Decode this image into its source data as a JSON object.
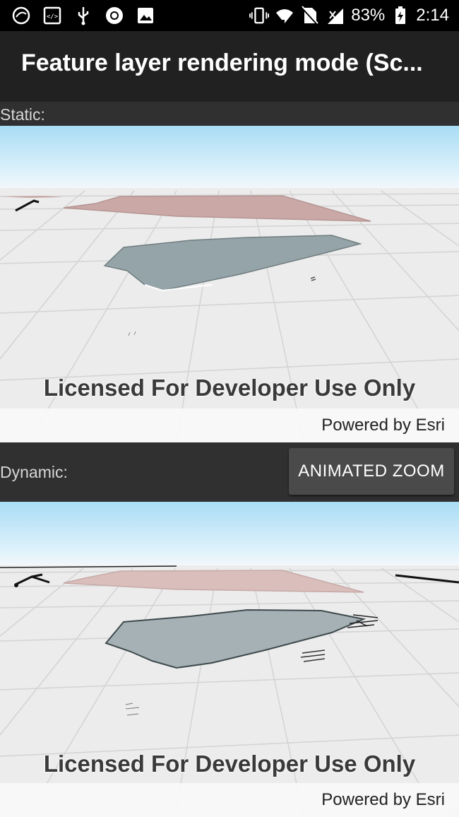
{
  "status_bar": {
    "battery": "83%",
    "time": "2:14",
    "left_icons": [
      "app-notification-icon",
      "code-icon",
      "usb-icon",
      "record-icon",
      "image-icon"
    ],
    "right_icons": [
      "vibrate-icon",
      "wifi-icon",
      "no-sim-icon",
      "signal-icon",
      "battery-charging-icon"
    ]
  },
  "app_bar": {
    "title": "Feature layer rendering mode (Sc..."
  },
  "static_section": {
    "label": "Static:",
    "watermark": "Licensed For Developer Use Only",
    "attribution": "Powered by Esri"
  },
  "dynamic_section": {
    "label": "Dynamic:",
    "button_label": "ANIMATED ZOOM",
    "watermark": "Licensed For Developer Use Only",
    "attribution": "Powered by Esri"
  },
  "colors": {
    "sky_top": "#a9dcf5",
    "ground": "#ececec",
    "polygon_pink": "#c9a8a6",
    "polygon_gray": "#95a4a8",
    "app_bar": "#212121",
    "button": "#4a4a4a"
  }
}
